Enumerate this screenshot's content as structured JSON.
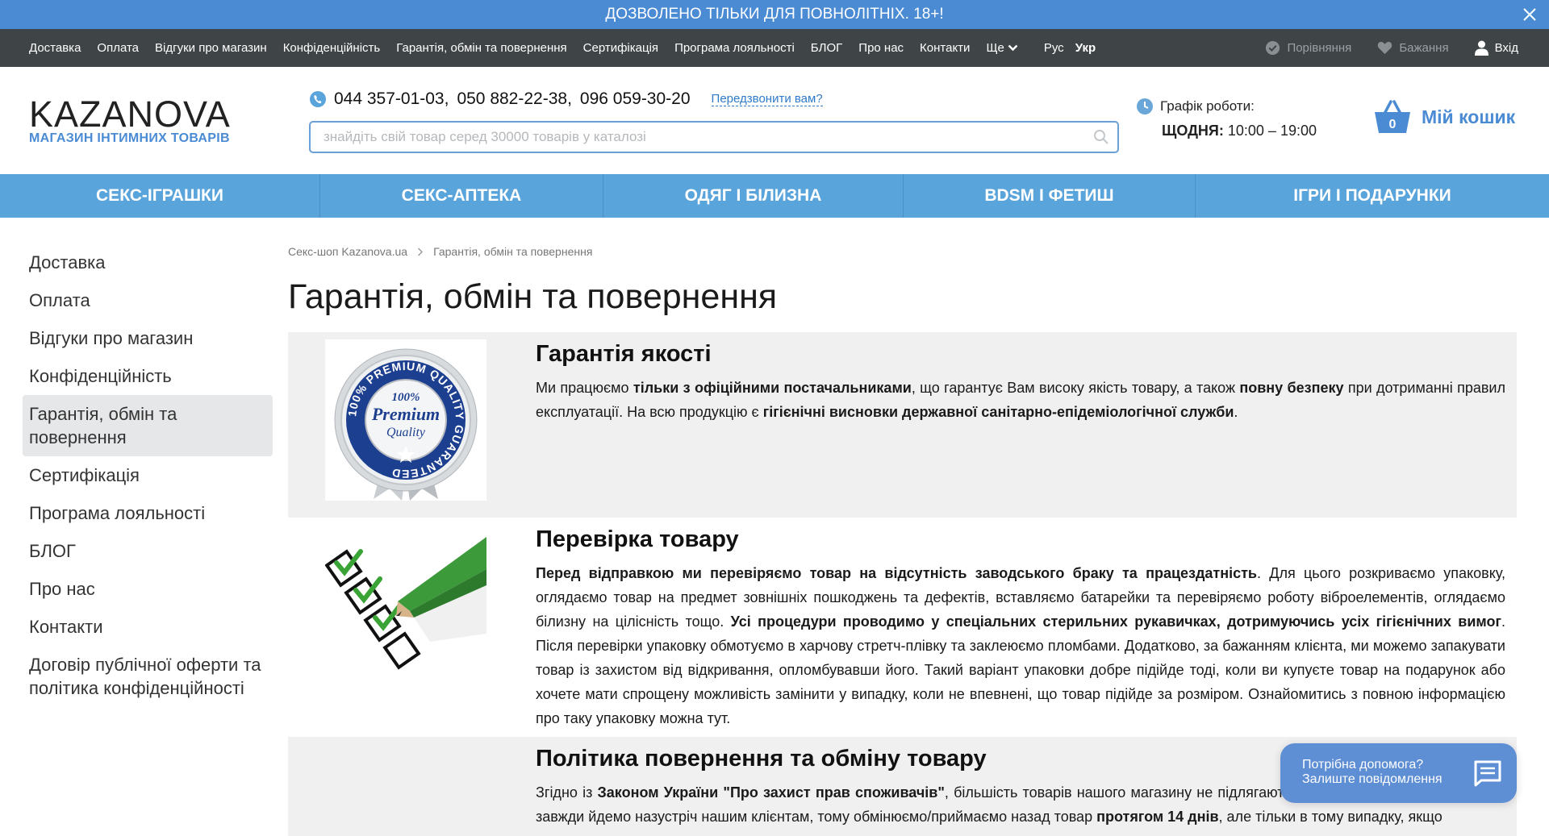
{
  "banner": {
    "text": "ДОЗВОЛЕНО ТІЛЬКИ ДЛЯ ПОВНОЛІТНІХ. 18+!"
  },
  "topnav": {
    "links": [
      "Доставка",
      "Оплата",
      "Відгуки про магазин",
      "Конфіденційність",
      "Гарантія, обмін та повернення",
      "Сертифікація",
      "Програма лояльності",
      "БЛОГ",
      "Про нас",
      "Контакти"
    ],
    "more": "Ще",
    "lang_ru": "Рус",
    "lang_uk": "Укр",
    "compare": "Порівняння",
    "wishlist": "Бажання",
    "login": "Вхід"
  },
  "header": {
    "logo_name": "KAZANOVA",
    "logo_sub": "МАГАЗИН ІНТИМНИХ ТОВАРІВ",
    "phone1": "044 357-01-03,",
    "phone2": "050 882-22-38,",
    "phone3": "096 059-30-20",
    "callback": "Передзвонити вам?",
    "search_placeholder": "знайдіть свій товар серед 30000 товарів у каталозі",
    "schedule_title": "Графік роботи:",
    "schedule_days": "ЩОДНЯ:",
    "schedule_hours": "10:00 – 19:00",
    "cart_count": "0",
    "cart_label": "Мій кошик"
  },
  "categories": [
    "СЕКС-ІГРАШКИ",
    "СЕКС-АПТЕКА",
    "ОДЯГ І БІЛИЗНА",
    "BDSM І ФЕТИШ",
    "ІГРИ І ПОДАРУНКИ"
  ],
  "sidebar": {
    "items": [
      "Доставка",
      "Оплата",
      "Відгуки про магазин",
      "Конфіденційність",
      "Гарантія, обмін та повернення",
      "Сертифікація",
      "Програма лояльності",
      "БЛОГ",
      "Про нас",
      "Контакти",
      "Договір публічної оферти та політика конфіденційності"
    ],
    "active_index": 4
  },
  "breadcrumb": {
    "home": "Секс-шоп Kazanova.ua",
    "current": "Гарантія, обмін та повернення"
  },
  "page_title": "Гарантія, обмін та повернення",
  "blocks": {
    "quality": {
      "title": "Гарантія якості",
      "seal_ring": "100% PREMIUM QUALITY GUARANTEED",
      "seal_top": "100%",
      "seal_mid": "Premium",
      "seal_bot": "Quality",
      "p": [
        {
          "t": "Ми працюємо "
        },
        {
          "t": "тільки з офіційними постачальниками",
          "b": true
        },
        {
          "t": ", що гарантує Вам високу якість товару, а також "
        },
        {
          "t": "повну безпеку",
          "b": true
        },
        {
          "t": " при дотриманні правил експлуатації. На всю продукцію є "
        },
        {
          "t": "гігієнічні висновки державної санітарно-епідеміологічної служби",
          "b": true
        },
        {
          "t": "."
        }
      ]
    },
    "check": {
      "title": "Перевірка товару",
      "p": [
        {
          "t": "Перед відправкою ми перевіряємо товар на відсутність заводського браку та працездатність",
          "b": true
        },
        {
          "t": ". Для цього розкриваємо упаковку, оглядаємо товар на предмет зовнішніх пошкоджень та дефектів, вставляємо батарейки та перевіряємо роботу віброелементів, оглядаємо білизну на цілісність тощо. "
        },
        {
          "t": "Усі процедури проводимо у спеціальних стерильних рукавичках, дотримуючись усіх гігієнічних вимог",
          "b": true
        },
        {
          "t": ". Після перевірки упаковку обмотуємо в харчову стретч-плівку та заклеюємо пломбами. Додатково, за бажанням клієнта, ми можемо запакувати товар із захистом від відкривання, опломбувавши його. Такий варіант упаковки добре підійде тоді, коли ви купуєте товар на подарунок або хочете мати спрощену можливість замінити у випадку, коли не впевнені, що товар підійде за розміром. Ознайомитись з повною інформацією про таку упаковку можна тут."
        }
      ]
    },
    "returns": {
      "title": "Політика повернення та обміну товару",
      "p": [
        {
          "t": "Згідно із "
        },
        {
          "t": "Законом України \"Про захист прав споживачів\"",
          "b": true
        },
        {
          "t": ", більшість товарів нашого магазину не підлягають поверненню. Тим не менш, ми завжди йдемо назустріч нашим клієнтам, тому обмінюємо/приймаємо назад товар "
        },
        {
          "t": "протягом 14 днів",
          "b": true
        },
        {
          "t": ", але тільки в тому випадку, якщо"
        }
      ]
    }
  },
  "chat": {
    "line1": "Потрібна допомога?",
    "line2": "Залиште повідомлення"
  },
  "colors": {
    "brand_blue": "#4a8bd4",
    "cat_nav": "#5aa4dc",
    "topnav": "#3f4447",
    "check_green": "#3aa335"
  }
}
